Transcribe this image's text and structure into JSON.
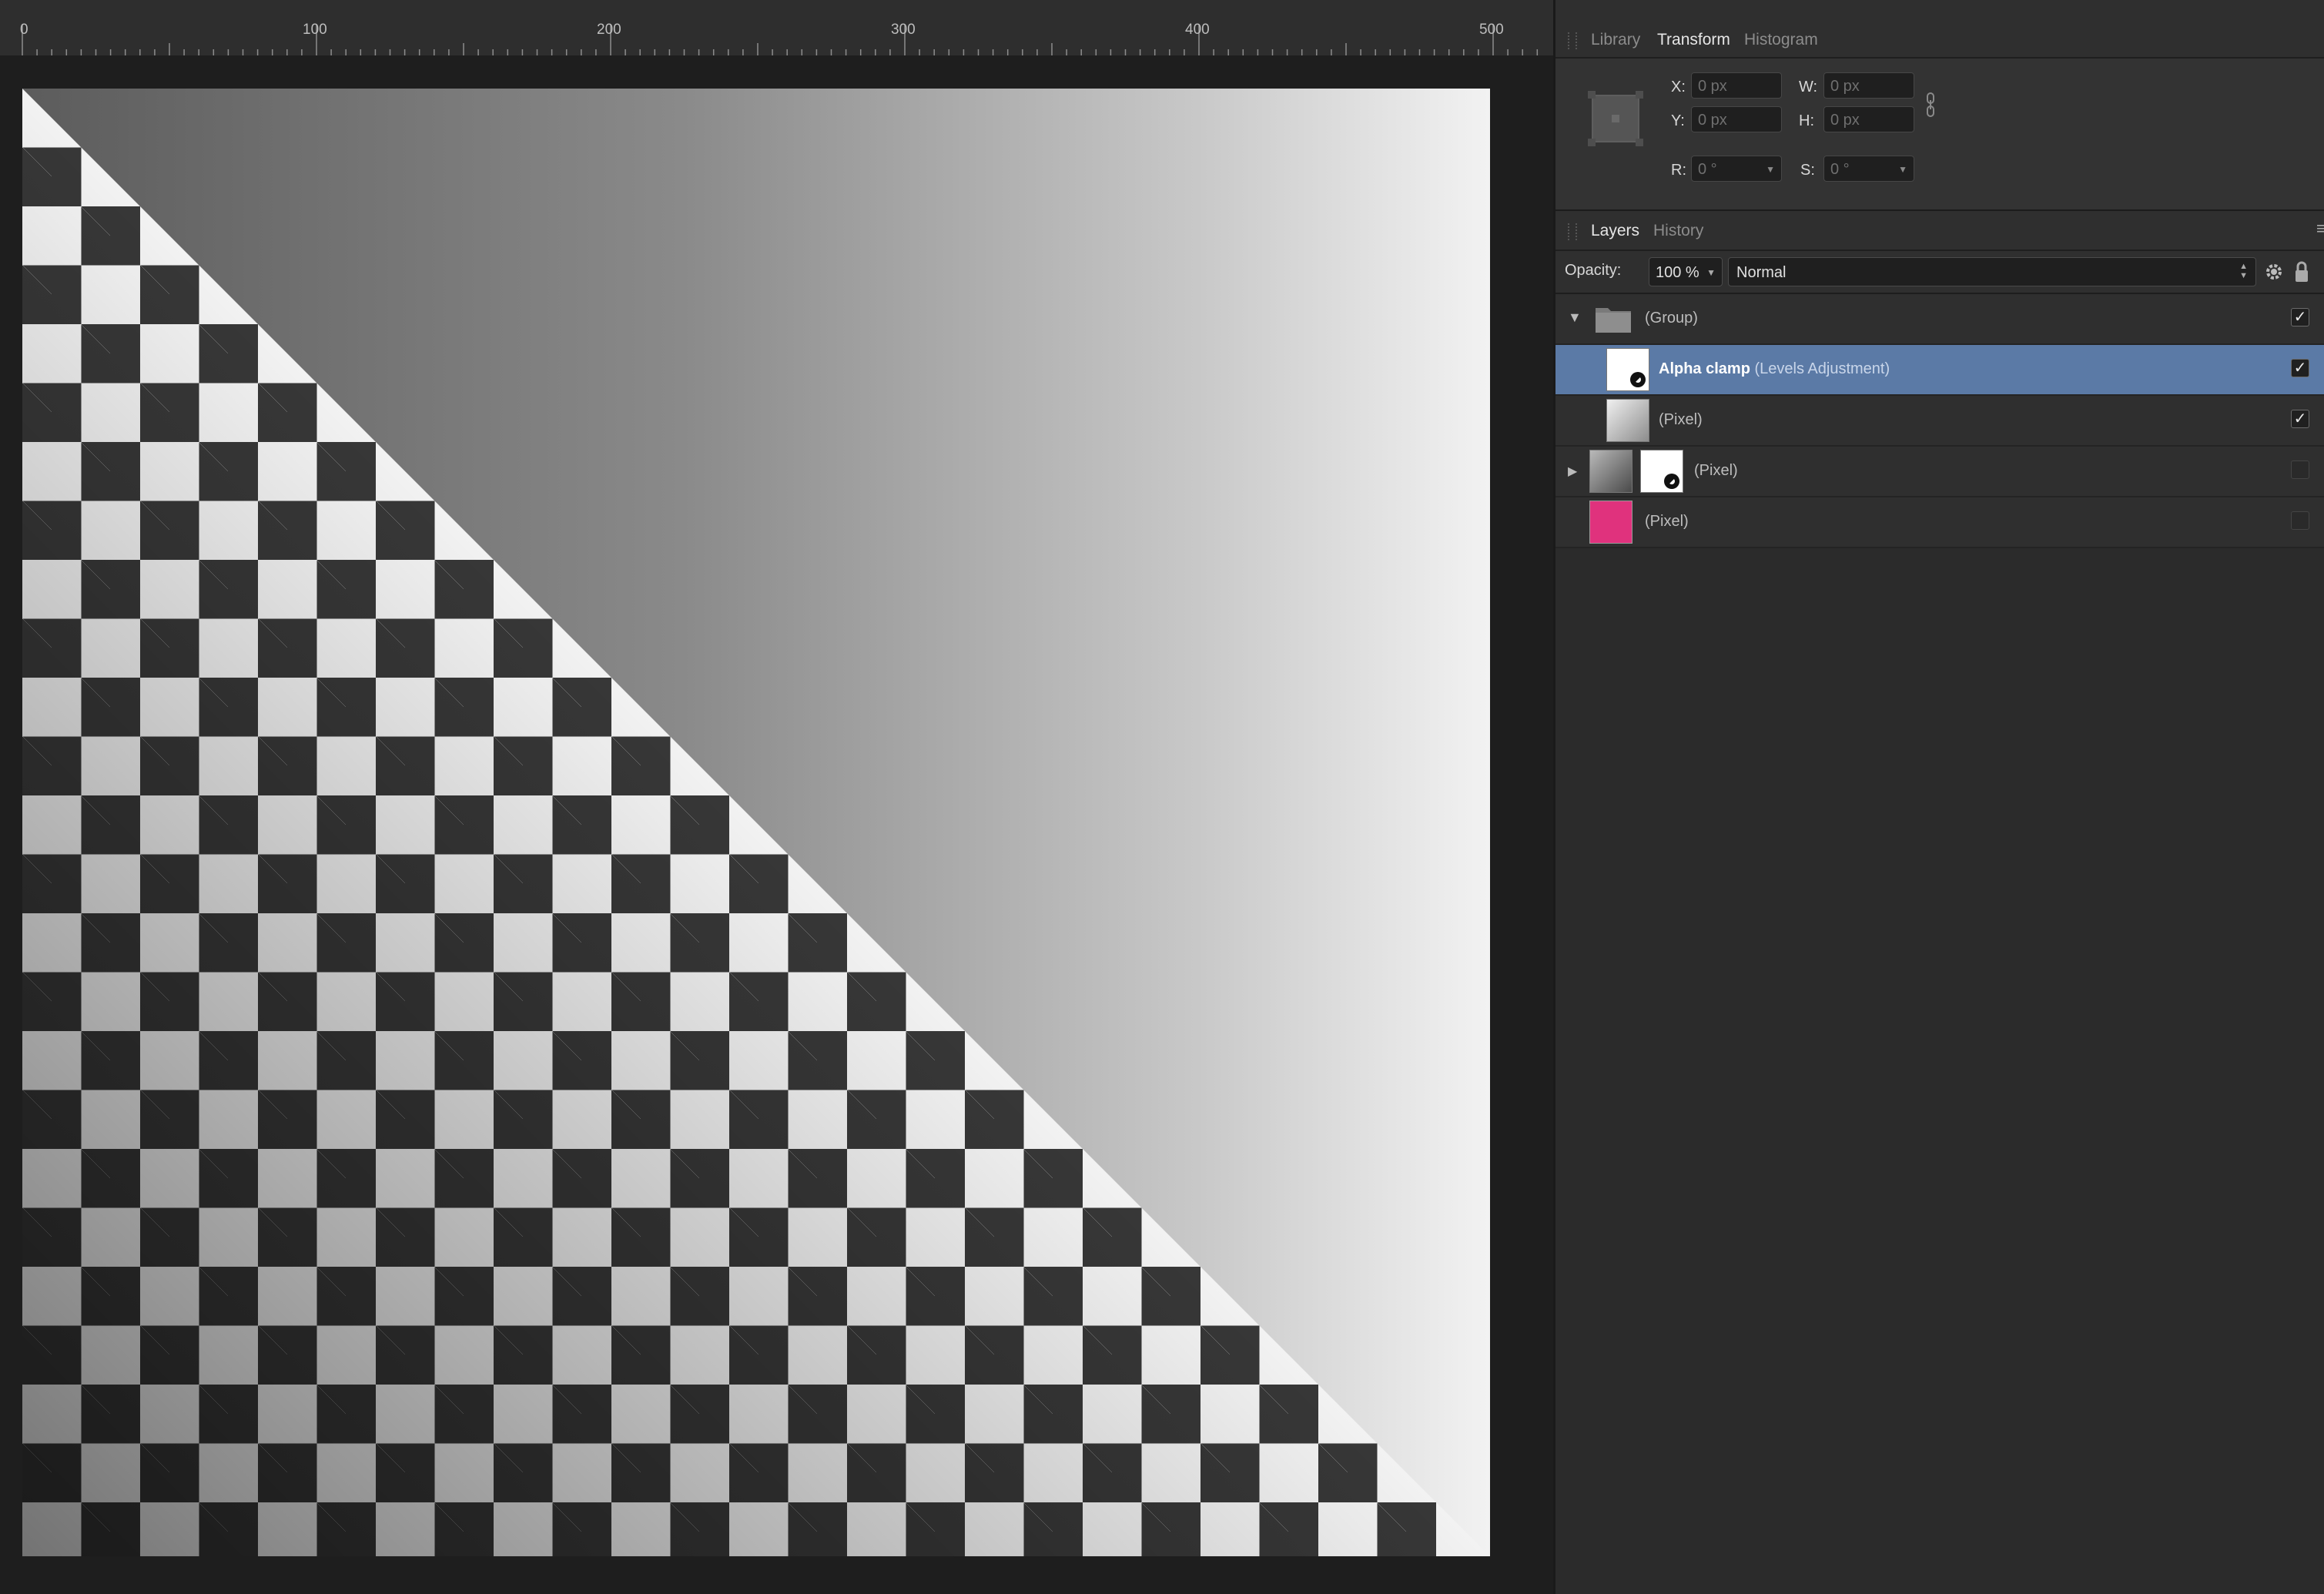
{
  "ruler": {
    "labels": [
      "0",
      "100",
      "200",
      "300",
      "400",
      "500"
    ]
  },
  "panel_tabs": [
    {
      "label": "Library",
      "active": false
    },
    {
      "label": "Transform",
      "active": true
    },
    {
      "label": "Histogram",
      "active": false
    }
  ],
  "transform": {
    "x_label": "X:",
    "x_value": "0 px",
    "y_label": "Y:",
    "y_value": "0 px",
    "w_label": "W:",
    "w_value": "0 px",
    "h_label": "H:",
    "h_value": "0 px",
    "r_label": "R:",
    "r_value": "0 °",
    "s_label": "S:",
    "s_value": "0 °"
  },
  "layers_tabs": [
    {
      "label": "Layers",
      "active": true
    },
    {
      "label": "History",
      "active": false
    }
  ],
  "layers_toolbar": {
    "opacity_label": "Opacity:",
    "opacity_value": "100 %",
    "blend_mode": "Normal"
  },
  "layers": [
    {
      "name": "(Group)",
      "visible": true,
      "expanded": true,
      "thumb": "folder-icon"
    },
    {
      "name": "Alpha clamp",
      "type": "(Levels Adjustment)",
      "visible": true,
      "selected": true,
      "thumb": "levels-adjustment-icon"
    },
    {
      "name": "(Pixel)",
      "visible": true
    },
    {
      "name": "(Pixel)",
      "visible": false,
      "expanded": false
    },
    {
      "name": "(Pixel)",
      "visible": false,
      "color": "#e0327d"
    }
  ],
  "colors": {
    "selection": "#5b7aa6",
    "panel_bg": "#2b2b2b",
    "canvas_bg": "#1e1e1e",
    "pink_layer": "#e0327d"
  }
}
